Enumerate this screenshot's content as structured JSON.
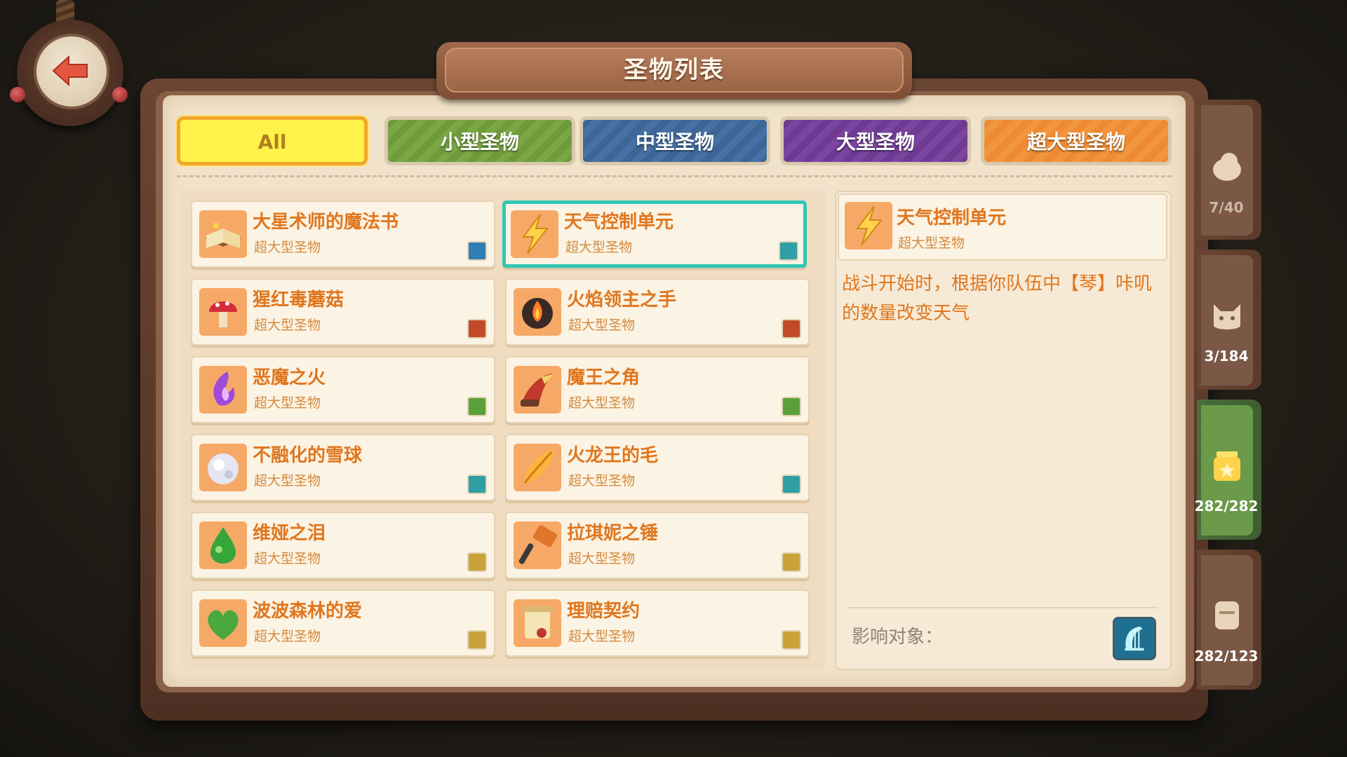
{
  "title": "圣物列表",
  "tabs": [
    {
      "label": "All",
      "active": true
    },
    {
      "label": "小型圣物",
      "active": false
    },
    {
      "label": "中型圣物",
      "active": false
    },
    {
      "label": "大型圣物",
      "active": false
    },
    {
      "label": "超大型圣物",
      "active": false
    }
  ],
  "relics": [
    {
      "name": "大星术师的魔法书",
      "type": "超大型圣物",
      "icon": "spellbook-icon",
      "badge": "blue-badge"
    },
    {
      "name": "天气控制单元",
      "type": "超大型圣物",
      "icon": "lightning-icon",
      "badge": "teal-badge",
      "selected": true
    },
    {
      "name": "猩红毒蘑菇",
      "type": "超大型圣物",
      "icon": "mushroom-icon",
      "badge": "red-badge"
    },
    {
      "name": "火焰领主之手",
      "type": "超大型圣物",
      "icon": "fire-hand-icon",
      "badge": "red-badge"
    },
    {
      "name": "恶魔之火",
      "type": "超大型圣物",
      "icon": "demon-fire-icon",
      "badge": "green-badge"
    },
    {
      "name": "魔王之角",
      "type": "超大型圣物",
      "icon": "horn-icon",
      "badge": "green-badge"
    },
    {
      "name": "不融化的雪球",
      "type": "超大型圣物",
      "icon": "snowball-icon",
      "badge": "teal-badge"
    },
    {
      "name": "火龙王的毛",
      "type": "超大型圣物",
      "icon": "feather-icon",
      "badge": "teal-badge"
    },
    {
      "name": "维娅之泪",
      "type": "超大型圣物",
      "icon": "green-gem-icon",
      "badge": "all-badge"
    },
    {
      "name": "拉琪妮之锤",
      "type": "超大型圣物",
      "icon": "hammer-icon",
      "badge": "all-badge"
    },
    {
      "name": "波波森林的爱",
      "type": "超大型圣物",
      "icon": "heart-icon",
      "badge": "all-badge"
    },
    {
      "name": "理赔契约",
      "type": "超大型圣物",
      "icon": "scroll-icon",
      "badge": "all-badge"
    }
  ],
  "detail": {
    "name": "天气控制单元",
    "type": "超大型圣物",
    "description": "战斗开始时，根据你队伍中【琴】咔叽的数量改变天气",
    "affect_label": "影响对象：",
    "affect_icon": "harp-icon"
  },
  "side_tabs": [
    {
      "count": "7/40",
      "icon": "chick-icon",
      "active": false
    },
    {
      "count": "3/184",
      "icon": "monster-icon",
      "active": false
    },
    {
      "count": "282/282",
      "icon": "jar-icon",
      "active": true
    },
    {
      "count": "282/123",
      "icon": "box-icon",
      "active": false
    }
  ],
  "colors": {
    "accent_orange": "#e0761e",
    "selected_border": "#2fc7b5",
    "tab_all": "#fff24a",
    "tab_small": "#6e9a3c",
    "tab_mid": "#3d6596",
    "tab_large": "#6e3a92",
    "tab_xl": "#ee8a32"
  }
}
